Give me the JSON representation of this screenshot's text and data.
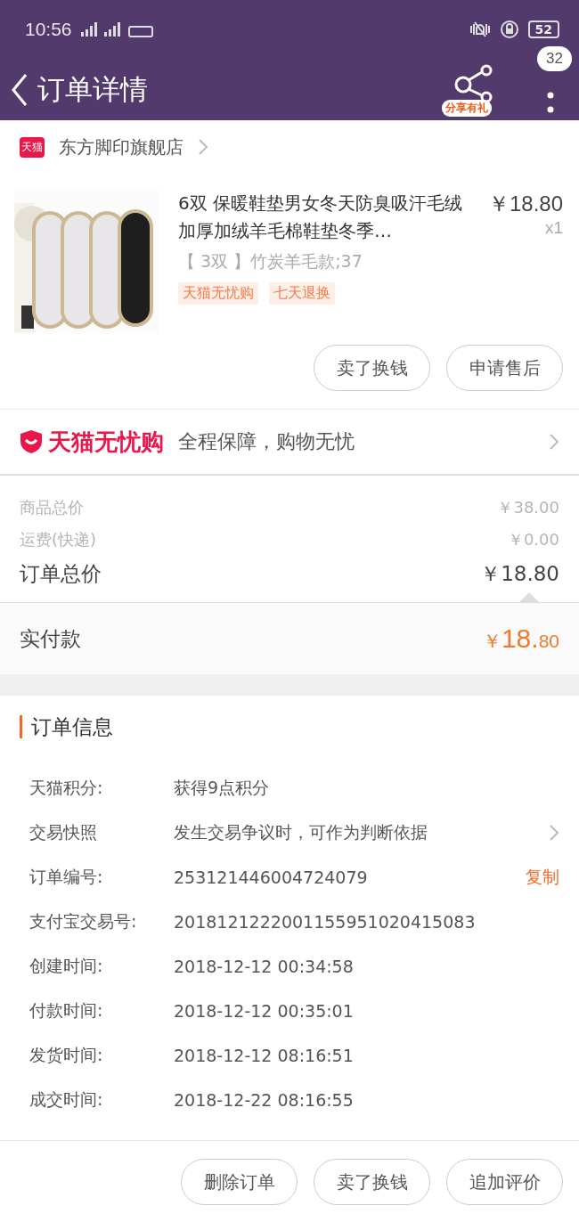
{
  "status_bar": {
    "time": "10:56",
    "battery": "52"
  },
  "header": {
    "title": "订单详情",
    "share_label": "分享有礼",
    "message_count": "32"
  },
  "shop": {
    "badge": "天猫",
    "name": "东方脚印旗舰店"
  },
  "product": {
    "title": "6双 保暖鞋垫男女冬天防臭吸汗毛绒加厚加绒羊毛棉鞋垫冬季…",
    "price": "￥18.80",
    "quantity": "x1",
    "sku": "【 3双 】竹炭羊毛款;37",
    "tags": [
      "天猫无忧购",
      "七天退换"
    ],
    "buttons": [
      "卖了换钱",
      "申请售后"
    ]
  },
  "guarantee": {
    "brand": "天猫无忧购",
    "slogan": "全程保障，购物无忧"
  },
  "prices": [
    {
      "label": "商品总价",
      "value": "￥38.00",
      "kind": "minor"
    },
    {
      "label": "运费(快递)",
      "value": "￥0.00",
      "kind": "minor"
    },
    {
      "label": "订单总价",
      "value": "￥18.80",
      "kind": "major"
    }
  ],
  "paid": {
    "label": "实付款",
    "currency": "￥",
    "integer": "18.",
    "decimal": "80"
  },
  "info": {
    "title": "订单信息",
    "rows": [
      {
        "label": "天猫积分:",
        "value": "获得9点积分",
        "kind": "text"
      },
      {
        "label": "交易快照",
        "value": "发生交易争议时，可作为判断依据",
        "kind": "link"
      },
      {
        "label": "订单编号:",
        "value": "253121446004724079",
        "kind": "copy",
        "action": "复制"
      },
      {
        "label": "支付宝交易号:",
        "value": "2018121222001155951020415083",
        "kind": "text"
      },
      {
        "label": "创建时间:",
        "value": "2018-12-12 00:34:58",
        "kind": "text"
      },
      {
        "label": "付款时间:",
        "value": "2018-12-12 00:35:01",
        "kind": "text"
      },
      {
        "label": "发货时间:",
        "value": "2018-12-12 08:16:51",
        "kind": "text"
      },
      {
        "label": "成交时间:",
        "value": "2018-12-22 08:16:55",
        "kind": "text"
      }
    ]
  },
  "bottom_buttons": [
    "删除订单",
    "卖了换钱",
    "追加评价"
  ]
}
